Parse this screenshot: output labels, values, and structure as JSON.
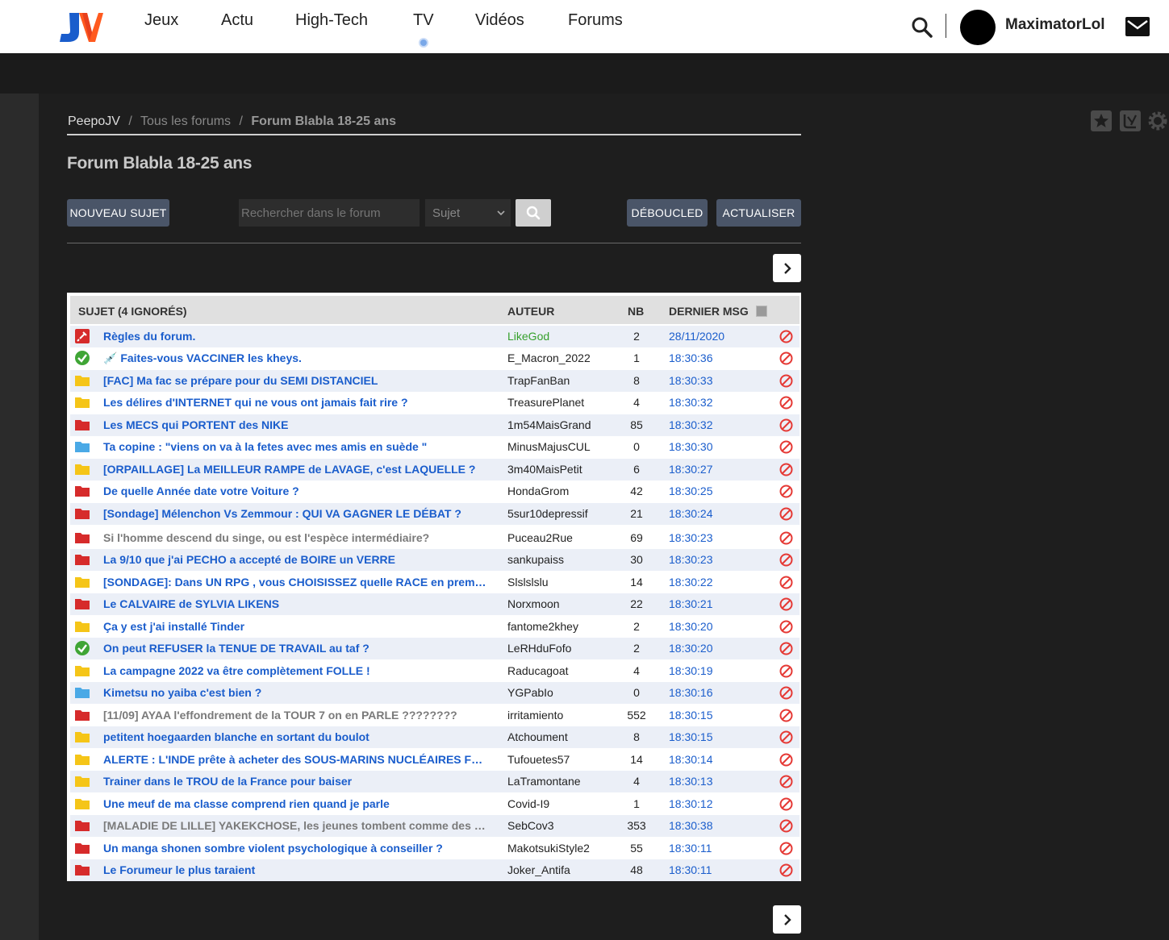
{
  "header": {
    "nav": [
      "Jeux",
      "Actu",
      "High-Tech",
      "TV",
      "Vidéos",
      "Forums"
    ],
    "username": "MaximatorLol"
  },
  "breadcrumb": {
    "home": "PeepoJV",
    "sep": "/",
    "all": "Tous les forums",
    "current": "Forum Blabla 18-25 ans"
  },
  "forum_title": "Forum Blabla 18-25 ans",
  "toolbar": {
    "new_topic": "NOUVEAU SUJET",
    "search_placeholder": "Rechercher dans le forum",
    "select_value": "Sujet",
    "deboucled": "DÉBOUCLED",
    "refresh": "ACTUALISER"
  },
  "table": {
    "col_subject": "SUJET (4 IGNORÉS)",
    "col_author": "AUTEUR",
    "col_nb": "NB",
    "col_last": "DERNIER MSG",
    "rows": [
      {
        "icon": "pin",
        "subject": "Règles du forum.",
        "author": "LikeGod",
        "nb": "2",
        "last": "28/11/2020"
      },
      {
        "icon": "check",
        "subject": "💉 Faites-vous VACCINER les kheys.",
        "author": "E_Macron_2022",
        "nb": "1",
        "last": "18:30:36"
      },
      {
        "icon": "folder-yellow",
        "subject": "[FAC] Ma fac se prépare pour du SEMI DISTANCIEL",
        "author": "TrapFanBan",
        "nb": "8",
        "last": "18:30:33"
      },
      {
        "icon": "folder-yellow",
        "subject": "Les délires d'INTERNET qui ne vous ont jamais fait rire ?",
        "author": "TreasurePlanet",
        "nb": "4",
        "last": "18:30:32"
      },
      {
        "icon": "folder-red",
        "subject": "Les MECS qui PORTENT des NIKE",
        "author": "1m54MaisGrand",
        "nb": "85",
        "last": "18:30:32"
      },
      {
        "icon": "folder-blue",
        "subject": "Ta copine : \"viens on va à la fetes avec mes amis en suède \"",
        "author": "MinusMajusCUL",
        "nb": "0",
        "last": "18:30:30"
      },
      {
        "icon": "folder-yellow",
        "subject": "[ORPAILLAGE] La MEILLEUR RAMPE de LAVAGE, c'est LAQUELLE ?",
        "author": "3m40MaisPetit",
        "nb": "6",
        "last": "18:30:27"
      },
      {
        "icon": "folder-red",
        "subject": "De quelle Année date votre Voiture ?",
        "author": "HondaGrom",
        "nb": "42",
        "last": "18:30:25"
      },
      {
        "icon": "folder-red",
        "subject": "[Sondage] Mélenchon Vs Zemmour : QUI VA GAGNER LE DÉBAT ?",
        "author": "5sur10depressif",
        "nb": "21",
        "last": "18:30:24"
      },
      {
        "icon": "folder-red",
        "subject": "Si l'homme descend du singe, ou est l'espèce intermédiaire?",
        "author": "Puceau2Rue",
        "nb": "69",
        "last": "18:30:23",
        "grey": true
      },
      {
        "icon": "folder-red",
        "subject": "La 9/10 que j'ai PECHO a accepté de BOIRE un VERRE",
        "author": "sankupaiss",
        "nb": "30",
        "last": "18:30:23"
      },
      {
        "icon": "folder-yellow",
        "subject": "[SONDAGE]: Dans UN RPG , vous CHOISISSEZ quelle RACE en premier ?",
        "author": "Slslslslu",
        "nb": "14",
        "last": "18:30:22"
      },
      {
        "icon": "folder-red",
        "subject": "Le CALVAIRE de SYLVIA LIKENS",
        "author": "Norxmoon",
        "nb": "22",
        "last": "18:30:21"
      },
      {
        "icon": "folder-yellow",
        "subject": "Ça y est j'ai installé Tinder",
        "author": "fantome2khey",
        "nb": "2",
        "last": "18:30:20"
      },
      {
        "icon": "check",
        "subject": "On peut REFUSER la TENUE DE TRAVAIL au taf ?",
        "author": "LeRHduFofo",
        "nb": "2",
        "last": "18:30:20"
      },
      {
        "icon": "folder-yellow",
        "subject": "La campagne 2022 va être complètement FOLLE !",
        "author": "Raducagoat",
        "nb": "4",
        "last": "18:30:19"
      },
      {
        "icon": "folder-blue",
        "subject": "Kimetsu no yaiba c'est bien ?",
        "author": "YGPabIo",
        "nb": "0",
        "last": "18:30:16"
      },
      {
        "icon": "folder-red",
        "subject": "[11/09] AYAA l'effondrement de la TOUR 7 on en PARLE ????????",
        "author": "irritamiento",
        "nb": "552",
        "last": "18:30:15",
        "grey": true
      },
      {
        "icon": "folder-yellow",
        "subject": "petitent hoegaarden blanche en sortant du boulot",
        "author": "Atchoument",
        "nb": "8",
        "last": "18:30:15"
      },
      {
        "icon": "folder-yellow",
        "subject": "ALERTE : L'INDE prête à acheter des SOUS-MARINS NUCLÉAIRES FRANÇAIS",
        "author": "Tufouetes57",
        "nb": "14",
        "last": "18:30:14"
      },
      {
        "icon": "folder-yellow",
        "subject": "Trainer dans le TROU de la France pour baiser",
        "author": "LaTramontane",
        "nb": "4",
        "last": "18:30:13"
      },
      {
        "icon": "folder-yellow",
        "subject": "Une meuf de ma classe comprend rien quand je parle",
        "author": "Covid-I9",
        "nb": "1",
        "last": "18:30:12"
      },
      {
        "icon": "folder-red",
        "subject": "[MALADIE DE LILLE] YAKEKCHOSE, les jeunes tombent comme des mouches",
        "author": "SebCov3",
        "nb": "353",
        "last": "18:30:38",
        "grey": true
      },
      {
        "icon": "folder-red",
        "subject": "Un manga shonen sombre violent psychologique à conseiller ?",
        "author": "MakotsukiStyle2",
        "nb": "55",
        "last": "18:30:11"
      },
      {
        "icon": "folder-red",
        "subject": "Le Forumeur le plus taraient",
        "author": "Joker_Antifa",
        "nb": "48",
        "last": "18:30:11"
      }
    ]
  },
  "colors": {
    "link": "#1a5dcc",
    "button": "#4a5568",
    "folder_yellow": "#f5c518",
    "folder_red": "#d62b2b",
    "folder_blue": "#4aa9e6",
    "check_green": "#3fa535",
    "ban_red": "#e53935"
  }
}
